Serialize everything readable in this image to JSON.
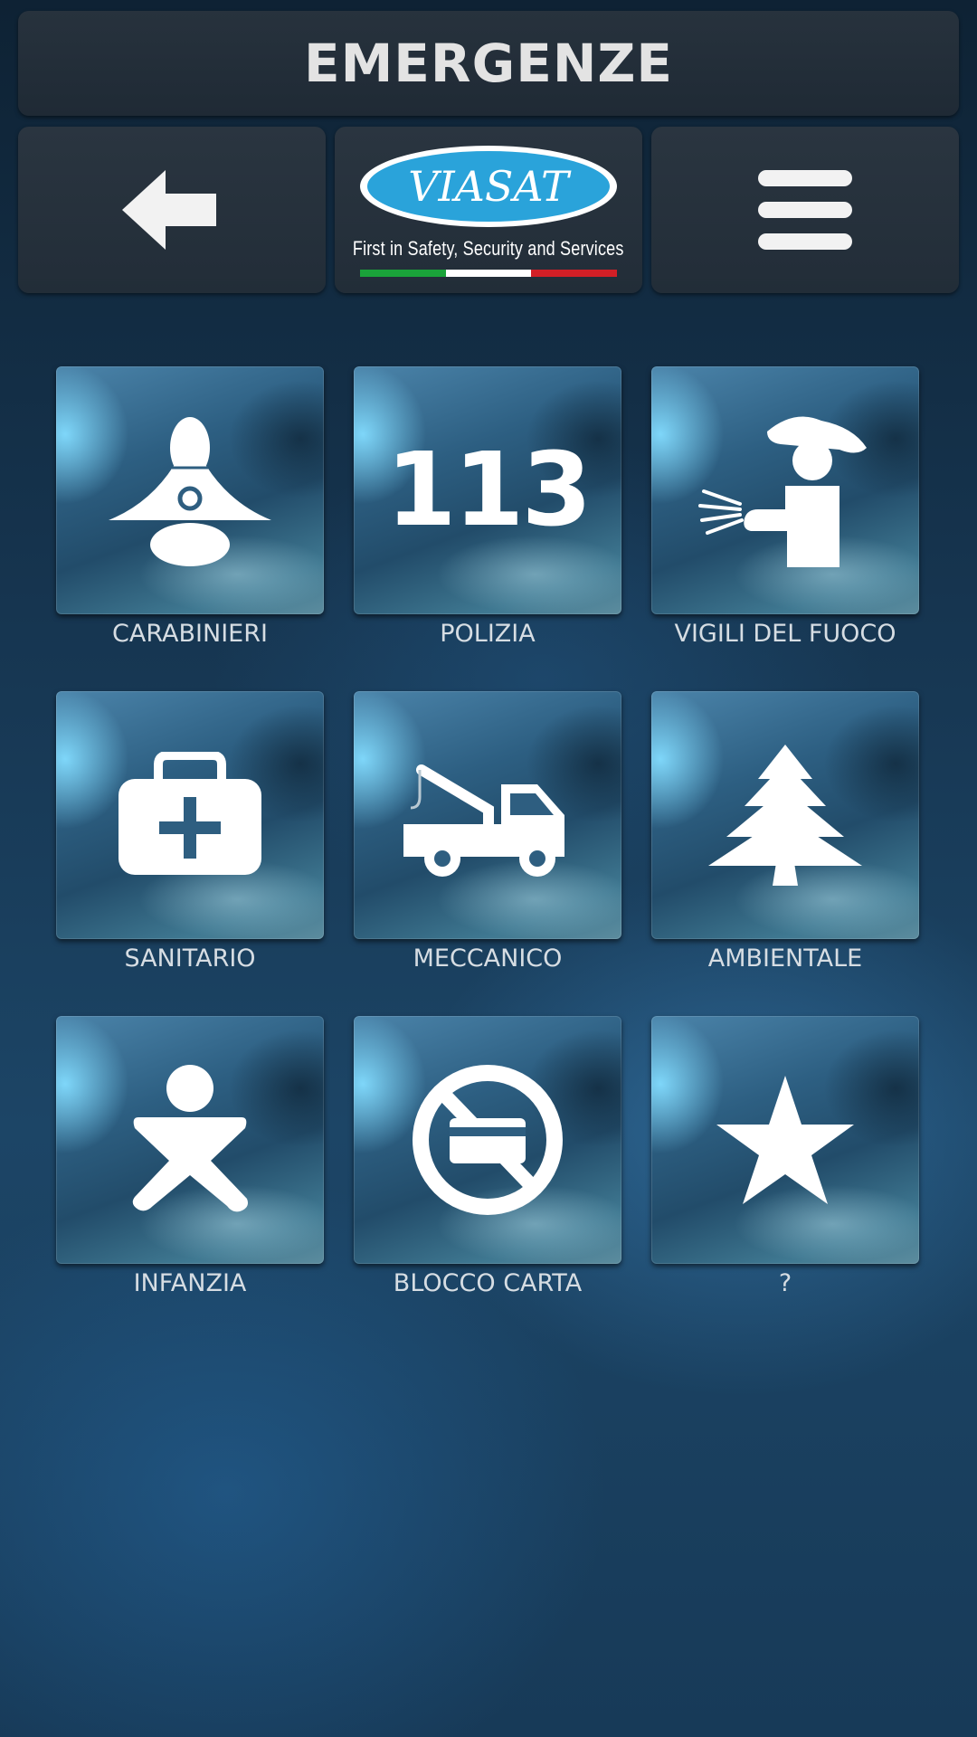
{
  "header": {
    "title": "EMERGENZE"
  },
  "nav": {
    "back_icon": "arrow-left-icon",
    "menu_icon": "hamburger-menu-icon"
  },
  "logo": {
    "brand": "VIASAT",
    "tagline": "First in Safety, Security and Services",
    "flag_colors": [
      "#1aa33a",
      "#ffffff",
      "#d21f26"
    ]
  },
  "tiles": [
    {
      "label": "CARABINIERI",
      "icon": "carabiniere-icon"
    },
    {
      "label": "POLIZIA",
      "icon": "number-113-icon",
      "icon_text": "113"
    },
    {
      "label": "VIGILI DEL FUOCO",
      "icon": "firefighter-icon"
    },
    {
      "label": "SANITARIO",
      "icon": "first-aid-kit-icon"
    },
    {
      "label": "MECCANICO",
      "icon": "tow-truck-icon"
    },
    {
      "label": "AMBIENTALE",
      "icon": "pine-tree-icon"
    },
    {
      "label": "INFANZIA",
      "icon": "child-icon"
    },
    {
      "label": "BLOCCO CARTA",
      "icon": "card-block-icon"
    },
    {
      "label": "?",
      "icon": "star-icon"
    }
  ]
}
